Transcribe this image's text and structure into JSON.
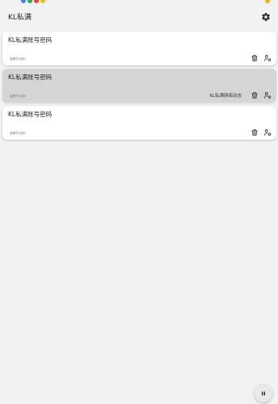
{
  "app": {
    "title": "KL私满"
  },
  "toolbar": {
    "settings_icon": "gear-icon"
  },
  "statusbar": {
    "dot_colors": [
      "#4285f4",
      "#34a853",
      "#ea4335",
      "#fbbc05"
    ],
    "corner_color": "#f4b400"
  },
  "cards": [
    {
      "title": "KL私满账号密码",
      "subtitle": "高德节点新1",
      "status": "",
      "selected": false
    },
    {
      "title": "KL私满账号密码",
      "subtitle": "高德节点新2",
      "status": "KL私满网络动态",
      "selected": true
    },
    {
      "title": "KL私满账号密码",
      "subtitle": "高德节点新3",
      "status": "",
      "selected": false
    }
  ],
  "icons": {
    "delete": "trash-icon",
    "account": "person-settings-icon",
    "fab": "pause-icon"
  },
  "colors": {
    "background": "#f2f2f2",
    "card": "#ffffff",
    "card_selected": "#d5d5d5",
    "icon": "#333333"
  }
}
